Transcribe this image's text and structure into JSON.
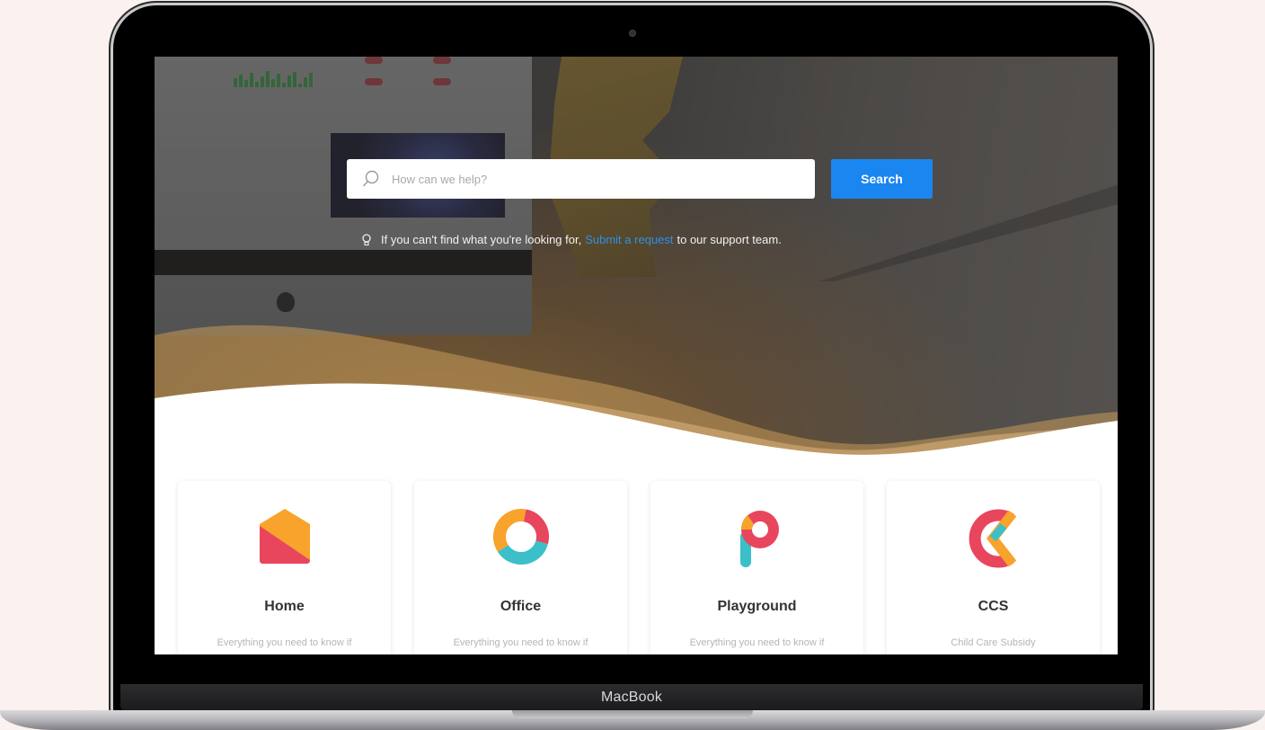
{
  "device": {
    "label": "MacBook"
  },
  "search": {
    "placeholder": "How can we help?",
    "button_label": "Search"
  },
  "help": {
    "prefix": "If you can't find what you're looking for,",
    "link": "Submit a request",
    "suffix": "to our support team."
  },
  "cards": [
    {
      "title": "Home",
      "description": "Everything you need to know if",
      "icon": "home-icon"
    },
    {
      "title": "Office",
      "description": "Everything you need to know if",
      "icon": "office-icon"
    },
    {
      "title": "Playground",
      "description": "Everything you need to know if",
      "icon": "playground-icon"
    },
    {
      "title": "CCS",
      "description": "Child Care Subsidy",
      "icon": "ccs-icon"
    }
  ],
  "colors": {
    "accent": "#1a86f0",
    "brand_red": "#e8465d",
    "brand_orange": "#f8a32b",
    "brand_teal": "#3bbfc9"
  }
}
